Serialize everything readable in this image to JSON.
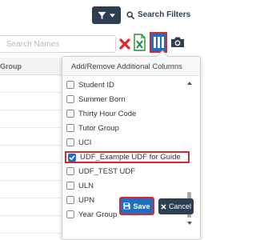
{
  "toolbar": {
    "search_filters_label": "Search Filters",
    "search_placeholder": "Search Names",
    "icons": {
      "filter": "filter-icon",
      "dropdown": "caret-down-icon",
      "search": "search-icon",
      "clear": "close-icon",
      "excel": "excel-export-icon",
      "columns": "columns-icon",
      "camera": "camera-icon"
    }
  },
  "grid": {
    "column_header": "Group"
  },
  "column_panel": {
    "title": "Add/Remove Additional Columns",
    "items": [
      {
        "label": "Student ID",
        "checked": false
      },
      {
        "label": "Summer Born",
        "checked": false
      },
      {
        "label": "Thirty Hour Code",
        "checked": false
      },
      {
        "label": "Tutor Group",
        "checked": false
      },
      {
        "label": "UCI",
        "checked": false
      },
      {
        "label": "UDF_Example UDF for Guide",
        "checked": true
      },
      {
        "label": "UDF_TEST UDF",
        "checked": false
      },
      {
        "label": "ULN",
        "checked": false
      },
      {
        "label": "UPN",
        "checked": false
      },
      {
        "label": "Year Group",
        "checked": false
      }
    ],
    "save_label": "Save",
    "cancel_label": "Cancel"
  },
  "colors": {
    "primary_blue": "#1e6fc3",
    "dark_navy": "#2c3e50",
    "highlight_red": "#d9262c",
    "excel_green": "#1e8e3e",
    "close_red": "#e3262b"
  }
}
